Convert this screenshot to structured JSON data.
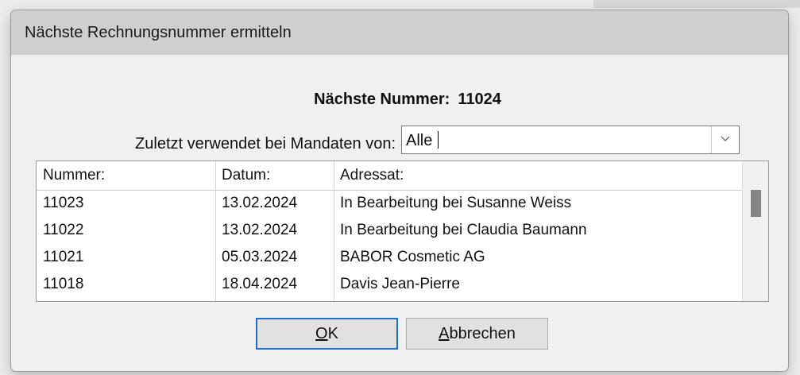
{
  "dialog": {
    "title": "Nächste Rechnungsnummer ermitteln",
    "next_label": "Nächste Nummer:",
    "next_value": "11024",
    "mandate_label": "Zuletzt verwendet bei Mandaten von:",
    "mandate_value": "Alle",
    "columns": [
      "Nummer:",
      "Datum:",
      "Adressat:"
    ],
    "rows": [
      {
        "nummer": "11023",
        "datum": "13.02.2024",
        "adressat": "In Bearbeitung bei Susanne Weiss"
      },
      {
        "nummer": "11022",
        "datum": "13.02.2024",
        "adressat": "In Bearbeitung bei Claudia Baumann"
      },
      {
        "nummer": "11021",
        "datum": "05.03.2024",
        "adressat": "BABOR Cosmetic AG"
      },
      {
        "nummer": "11018",
        "datum": "18.04.2024",
        "adressat": "Davis Jean-Pierre"
      }
    ],
    "ok_mnemonic": "O",
    "ok_rest": "K",
    "cancel_mnemonic": "A",
    "cancel_rest": "bbrechen",
    "icons": [
      "chevron-down-icon"
    ]
  }
}
